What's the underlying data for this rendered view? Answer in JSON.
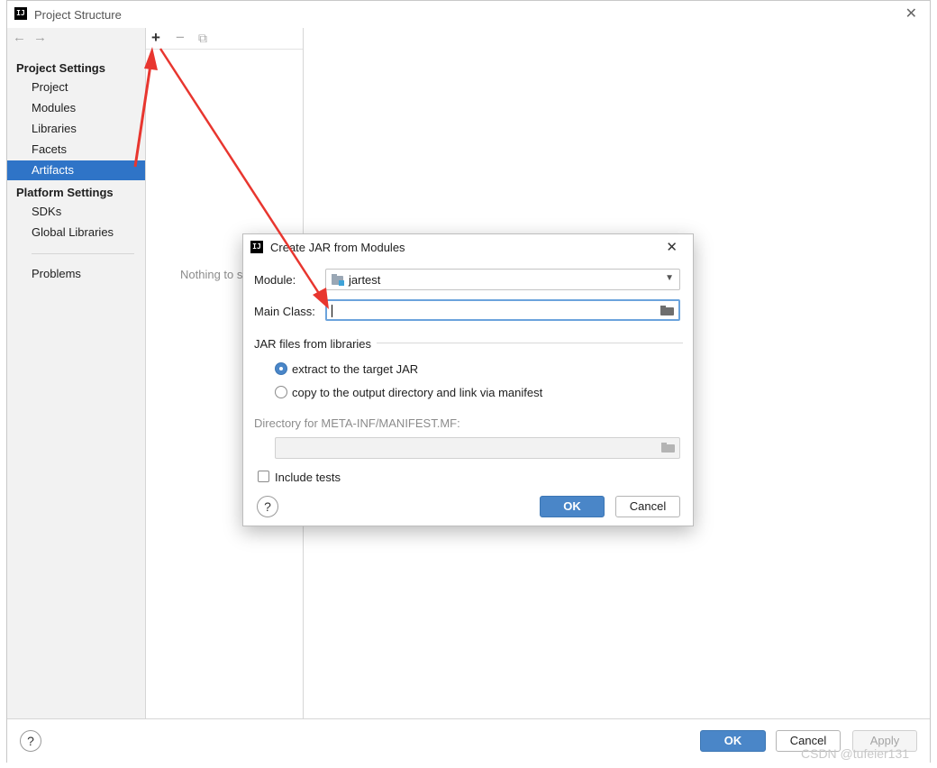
{
  "window": {
    "title": "Project Structure",
    "app_icon": "IJ"
  },
  "nav": {
    "back": "←",
    "forward": "→",
    "project_settings": "Project Settings",
    "platform_settings": "Platform Settings",
    "items": [
      "Project",
      "Modules",
      "Libraries",
      "Facets",
      "Artifacts"
    ],
    "platform_items": [
      "SDKs",
      "Global Libraries"
    ],
    "problems": "Problems",
    "selected": "Artifacts"
  },
  "artifacts_toolbar": {
    "add": "+",
    "remove": "−",
    "copy": "⧉"
  },
  "artifacts_empty": "Nothing to s",
  "footer": {
    "help": "?",
    "ok": "OK",
    "cancel": "Cancel",
    "apply": "Apply"
  },
  "dialog": {
    "title": "Create JAR from Modules",
    "icon": "IJ",
    "close": "✕",
    "module_label": "Module:",
    "module_value": "jartest",
    "main_class_label": "Main Class:",
    "main_class_value": "",
    "jar_group": "JAR files from libraries",
    "radio_extract": "extract to the target JAR",
    "radio_copy": "copy to the output directory and link via manifest",
    "selected_option": "extract to the target JAR",
    "manifest_label": "Directory for META-INF/MANIFEST.MF:",
    "manifest_value": "",
    "include_tests": "Include tests",
    "include_tests_checked": false,
    "help": "?",
    "ok": "OK",
    "cancel": "Cancel"
  },
  "watermark": "CSDN @tufeier131",
  "colors": {
    "selection": "#2f74c7",
    "primary_button": "#4a86c8",
    "annotation_arrow": "#e8362f"
  }
}
